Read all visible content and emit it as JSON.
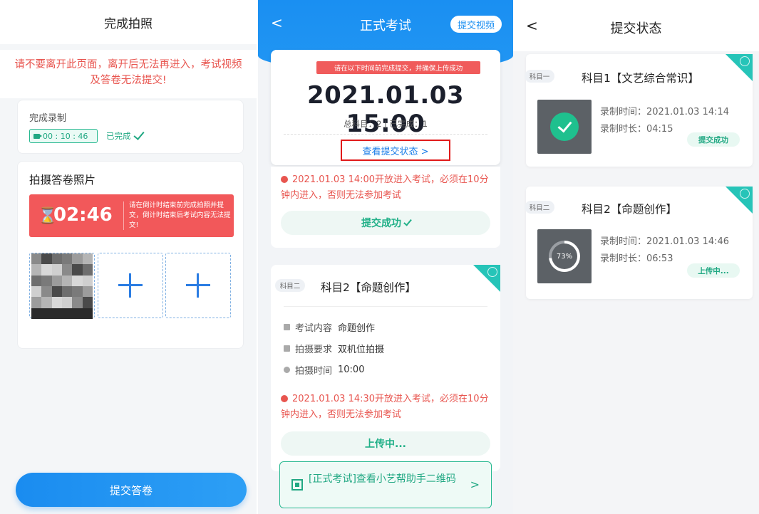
{
  "panel1": {
    "title": "完成拍照",
    "warning": "请不要离开此页面，离开后无法再进入，考试视频及答卷无法提交!",
    "recording": {
      "label": "完成录制",
      "duration": "00 : 10 : 46",
      "status": "已完成"
    },
    "photo": {
      "title": "拍摄答卷照片",
      "hourglass": "⌛",
      "countdown": "02:46",
      "countdown_note": "请在倒计时结束前完成拍照并提交，倒计时结束后考试内容无法提交!"
    },
    "submit_label": "提交答卷"
  },
  "panel2": {
    "back": "<",
    "title": "正式考试",
    "submit_video": "提交视频",
    "deadline_tag": "请在以下时间前完成提交，并确保上传成功",
    "deadline": "2021.01.03 15:00",
    "progress": "总科目：2 | 已完成：1",
    "view_status": "查看提交状态 >",
    "subject1": {
      "warning": "2021.01.03 14:00开放进入考试，必须在10分钟内进入，否则无法参加考试",
      "status": "提交成功"
    },
    "subject2": {
      "tag": "科目二",
      "name": "科目2【命题创作】",
      "rows": [
        {
          "key": "考试内容",
          "value": "命题创作"
        },
        {
          "key": "拍摄要求",
          "value": "双机位拍摄"
        },
        {
          "key": "拍摄时间",
          "value": "10:00"
        }
      ],
      "warning": "2021.01.03 14:30开放进入考试，必须在10分钟内进入，否则无法参加考试",
      "status": "上传中..."
    },
    "qr_link": "[正式考试]查看小艺帮助手二维码",
    "qr_arrow": ">"
  },
  "panel3": {
    "back": "<",
    "title": "提交状态",
    "cards": [
      {
        "tag": "科目一",
        "name": "科目1【文艺综合常识】",
        "record_time": "录制时间：2021.01.03 14:14",
        "record_len": "录制时长：04:15",
        "status": "提交成功"
      },
      {
        "tag": "科目二",
        "name": "科目2【命题创作】",
        "record_time": "录制时间：2021.01.03 14:46",
        "record_len": "录制时长：06:53",
        "status": "上传中...",
        "progress": "73%"
      }
    ]
  },
  "colors": {
    "primary": "#1a8ff2",
    "success": "#21a883",
    "danger": "#e8554f",
    "teal_corner": "#26c4b8"
  }
}
